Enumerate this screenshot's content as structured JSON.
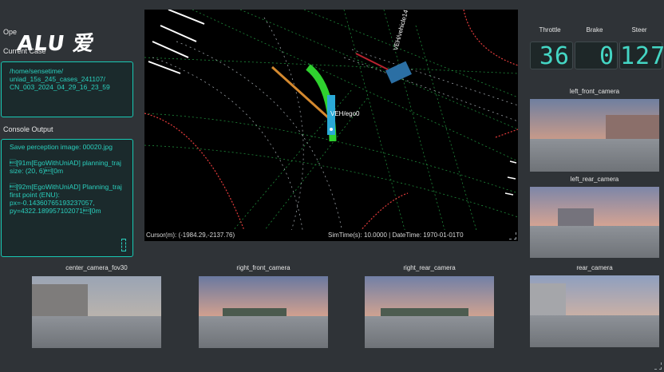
{
  "left_panel": {
    "open_label": "Ope",
    "logo_text": "ALU 爱",
    "current_case_label": "Current Case",
    "case_path": [
      "/home/sensetime/",
      "uniad_15s_245_cases_241107/",
      "CN_003_2024_04_29_16_23_59"
    ],
    "console_label": "Console Output",
    "console_lines": [
      "Save perception image: 00020.jpg",
      "\u001b[91m[EgoWithUniAD] planning_traj size: (20, 6)\u001b[0m",
      "\u001b[92m[EgoWithUniAD] Planning_traj first point (ENU): px=-0.14360765193237057, py=4322.189957102071\u001b[0m"
    ]
  },
  "viewport": {
    "ego_label": "VEH/ego0",
    "vehicle_label": "VEH/vehicle14",
    "cursor_text": "Cursor(m): (-1984.29,-2137.76)",
    "sim_text": "SimTime(s): 10.0000 | DateTime: 1970-01-01T0"
  },
  "gauges": {
    "throttle_label": "Throttle",
    "brake_label": "Brake",
    "steer_label": "Steer",
    "throttle_value": "36",
    "brake_value": "0",
    "steer_value": "127"
  },
  "cameras": {
    "left_front": "left_front_camera",
    "left_rear": "left_rear_camera",
    "center": "center_camera_fov30",
    "right_front": "right_front_camera",
    "right_rear": "right_rear_camera",
    "rear": "rear_camera"
  },
  "colors": {
    "accent": "#18c9b4",
    "ego_green": "#2fd12f",
    "lane_red": "#e23b3b"
  }
}
